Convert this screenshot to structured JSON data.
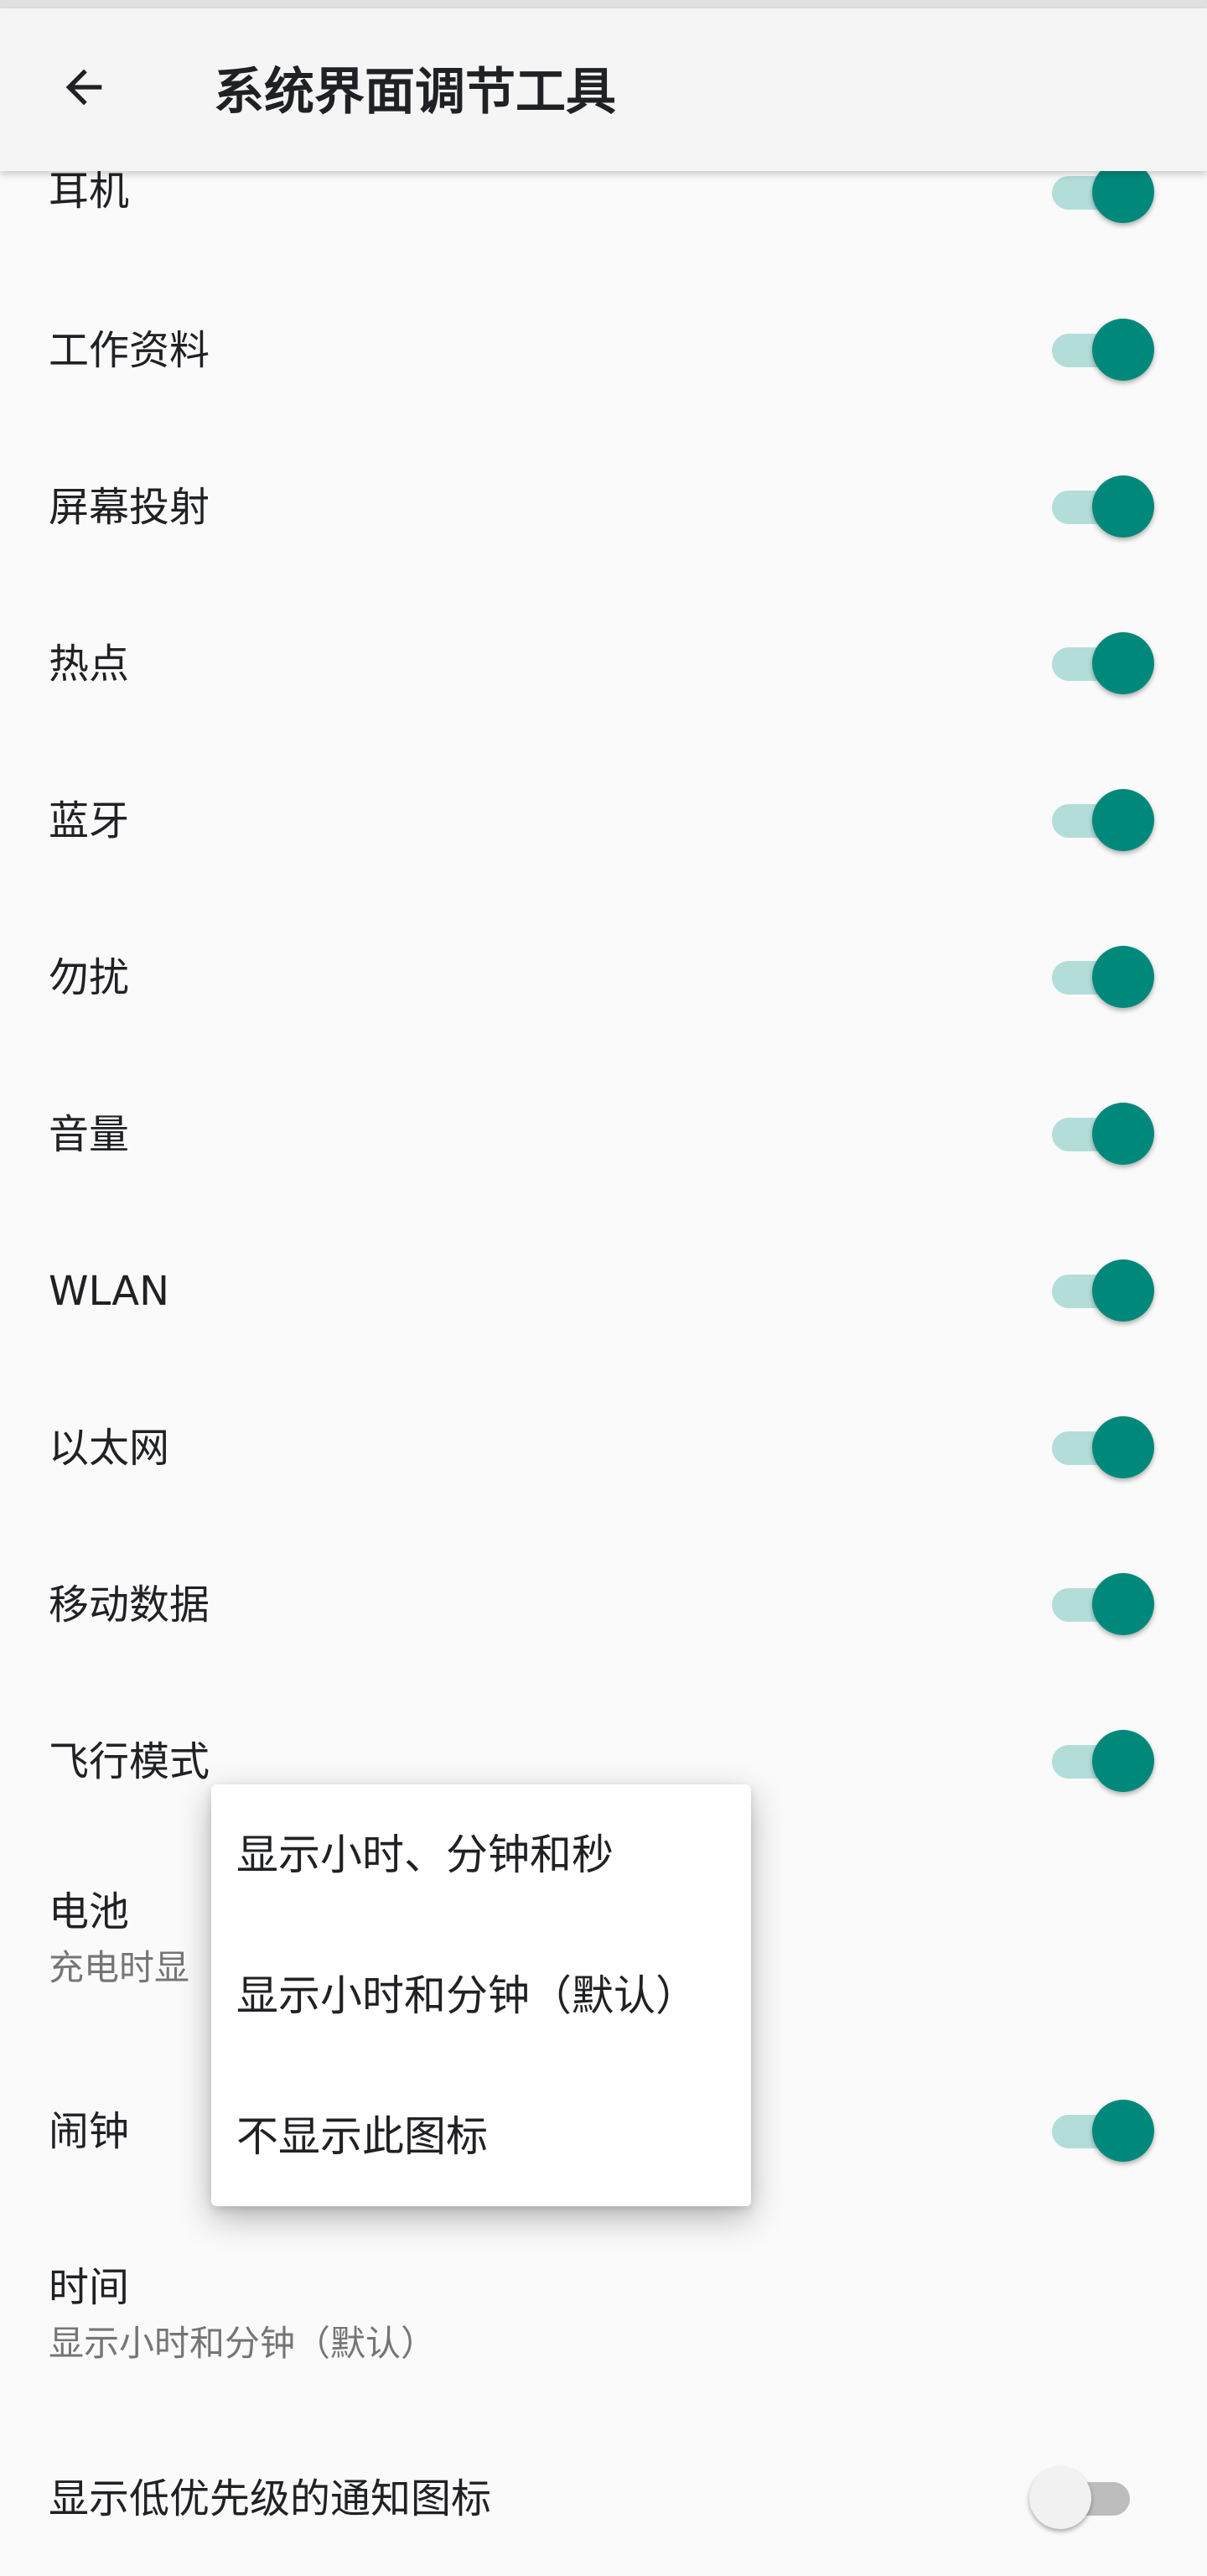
{
  "toolbar": {
    "title": "系统界面调节工具",
    "back_icon": "arrow-left-icon"
  },
  "rows": [
    {
      "title": "耳机",
      "checked": true
    },
    {
      "title": "工作资料",
      "checked": true
    },
    {
      "title": "屏幕投射",
      "checked": true
    },
    {
      "title": "热点",
      "checked": true
    },
    {
      "title": "蓝牙",
      "checked": true
    },
    {
      "title": "勿扰",
      "checked": true
    },
    {
      "title": "音量",
      "checked": true
    },
    {
      "title": "WLAN",
      "checked": true
    },
    {
      "title": "以太网",
      "checked": true
    },
    {
      "title": "移动数据",
      "checked": true
    },
    {
      "title": "飞行模式",
      "checked": true
    }
  ],
  "battery": {
    "title": "电池",
    "summary": "充电时显"
  },
  "alarm": {
    "title": "闹钟",
    "checked": true
  },
  "time": {
    "title": "时间",
    "summary": "显示小时和分钟（默认）"
  },
  "low_priority": {
    "title": "显示低优先级的通知图标",
    "checked": false
  },
  "popup": {
    "options": [
      "显示小时、分钟和秒",
      "显示小时和分钟（默认）",
      "不显示此图标"
    ]
  },
  "colors": {
    "accent": "#00897b",
    "accent_track": "#b3ddd9"
  }
}
